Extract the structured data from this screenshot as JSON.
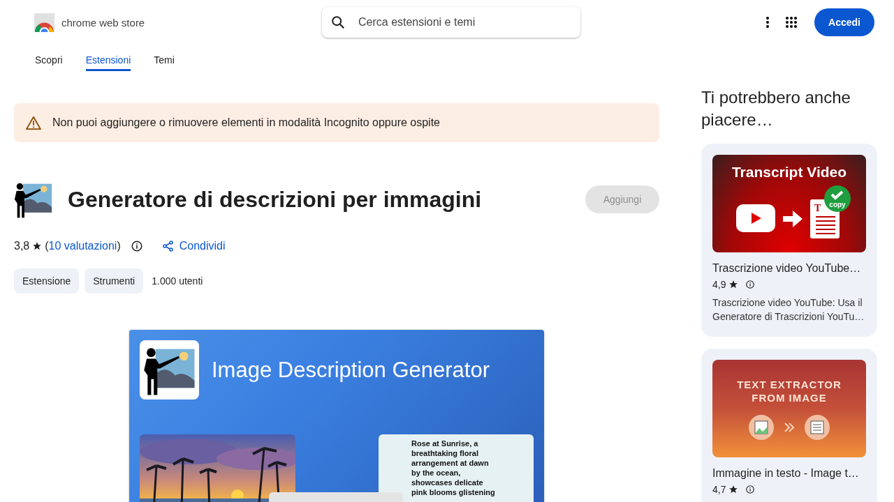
{
  "header": {
    "logo_text": "chrome web store",
    "search": {
      "placeholder": "Cerca estensioni e temi"
    },
    "sign_in": "Accedi"
  },
  "tabs": [
    {
      "label": "Scopri",
      "selected": false
    },
    {
      "label": "Estensioni",
      "selected": true
    },
    {
      "label": "Temi",
      "selected": false
    }
  ],
  "notice": "Non puoi aggiungere o rimuovere elementi in modalità Incognito oppure ospite",
  "extension": {
    "title": "Generatore di descrizioni per immagini",
    "add_button": {
      "label": "Aggiungi",
      "disabled": true
    },
    "rating": "3,8",
    "reviews_open": "(",
    "reviews_link": "10 valutazioni",
    "reviews_close": ")",
    "share": "Condividi",
    "tags": [
      "Estensione",
      "Strumenti"
    ],
    "users": "1.000 utenti"
  },
  "promo": {
    "title": "Image Description Generator",
    "caption": "Rose at Sunrise, a breathtaking floral arrangement at dawn by the ocean, showcases delicate pink blooms glistening"
  },
  "sidebar": {
    "title": "Ti potrebbero anche piacere…",
    "cards": [
      {
        "kind": "video",
        "thumb_title": "Transcript Video",
        "thumb_badge": "copy",
        "thumb_letter": "T",
        "name": "Trascrizione video YouTube…",
        "rating": "4,9",
        "description": "Trascrizione video YouTube: Usa il Generatore di Trascrizioni YouTu…"
      },
      {
        "kind": "extractor",
        "thumb_title": "TEXT EXTRACTOR FROM IMAGE",
        "name": "Immagine in testo - Image t…",
        "rating": "4,7"
      }
    ]
  }
}
